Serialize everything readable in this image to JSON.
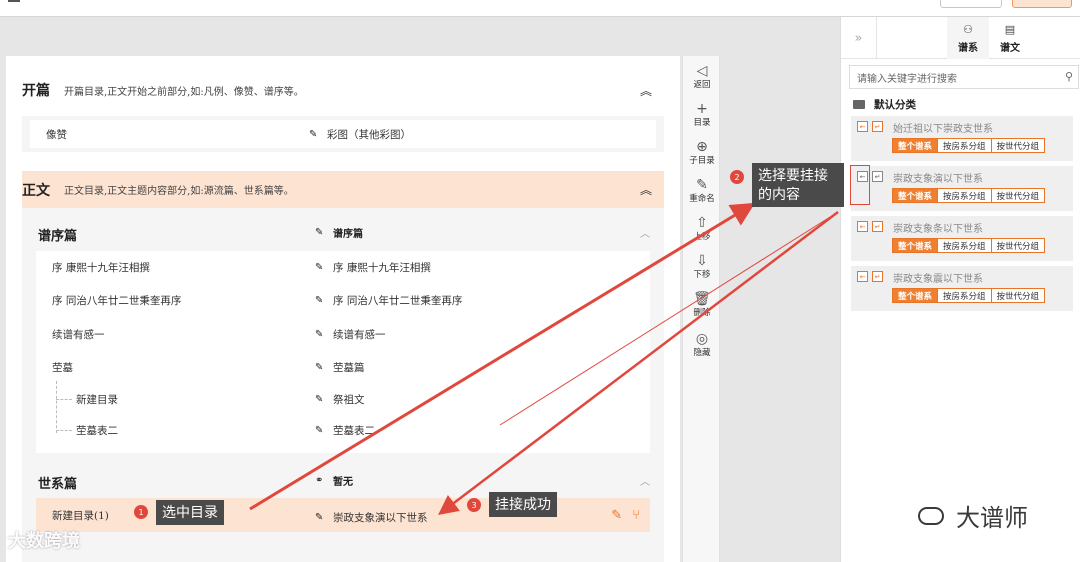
{
  "left_section_1": {
    "title": "开篇",
    "desc": "开篇目录,正文开始之前部分,如:凡例、像赞、谱序等。",
    "row": {
      "left": "像赞",
      "right": "彩图（其他彩图）"
    }
  },
  "left_section_2": {
    "title": "正文",
    "desc": "正文目录,正文主题内容部分,如:源流篇、世系篇等。",
    "group1": {
      "title": "谱序篇",
      "right": "谱序篇",
      "rows": [
        {
          "left": "序 康熙十九年汪相撰",
          "right": "序 康熙十九年汪相撰"
        },
        {
          "left": "序 同治八年廿二世秉奎再序",
          "right": "序 同治八年廿二世秉奎再序"
        },
        {
          "left": "续谱有感一",
          "right": "续谱有感一"
        },
        {
          "left": "茔墓",
          "right": "茔墓篇"
        },
        {
          "left": "新建目录",
          "right": "祭祖文"
        },
        {
          "left": "茔墓表二",
          "right": "茔墓表二"
        }
      ]
    },
    "group2": {
      "title": "世系篇",
      "right": "暂无",
      "row": {
        "left": "新建目录(1)",
        "right": "崇政支象演以下世系"
      }
    }
  },
  "toolbar": {
    "items": [
      {
        "icon": "◁",
        "label": "返回"
      },
      {
        "icon": "+",
        "label": "目录"
      },
      {
        "icon": "⊕",
        "label": "子目录"
      },
      {
        "icon": "✎",
        "label": "重命名"
      },
      {
        "icon": "⇧",
        "label": "上移"
      },
      {
        "icon": "⇩",
        "label": "下移"
      },
      {
        "icon": "🗑",
        "label": "删除"
      },
      {
        "icon": "◎",
        "label": "隐藏"
      }
    ]
  },
  "right_panel": {
    "tabs": [
      {
        "icon": "⚇",
        "label": "谱系"
      },
      {
        "icon": "▤",
        "label": "谱文"
      }
    ],
    "search_placeholder": "请输入关键字进行搜索",
    "folder": "默认分类",
    "items": [
      {
        "name": "始迁祖以下崇政支世系",
        "buttons": [
          "整个谱系",
          "按房系分组",
          "按世代分组"
        ]
      },
      {
        "name": "崇政支象演以下世系",
        "buttons": [
          "整个谱系",
          "按房系分组",
          "按世代分组"
        ]
      },
      {
        "name": "崇政支象条以下世系",
        "buttons": [
          "整个谱系",
          "按房系分组",
          "按世代分组"
        ]
      },
      {
        "name": "崇政支象震以下世系",
        "buttons": [
          "整个谱系",
          "按房系分组",
          "按世代分组"
        ]
      }
    ]
  },
  "annotations": {
    "step1": {
      "num": "1",
      "text": "选中目录"
    },
    "step2": {
      "num": "2",
      "text": "选择要挂接的内容"
    },
    "step3": {
      "num": "3",
      "text": "挂接成功"
    },
    "accent": "#e0483e"
  },
  "watermarks": {
    "left": "大数跨境",
    "right": "大谱师"
  }
}
